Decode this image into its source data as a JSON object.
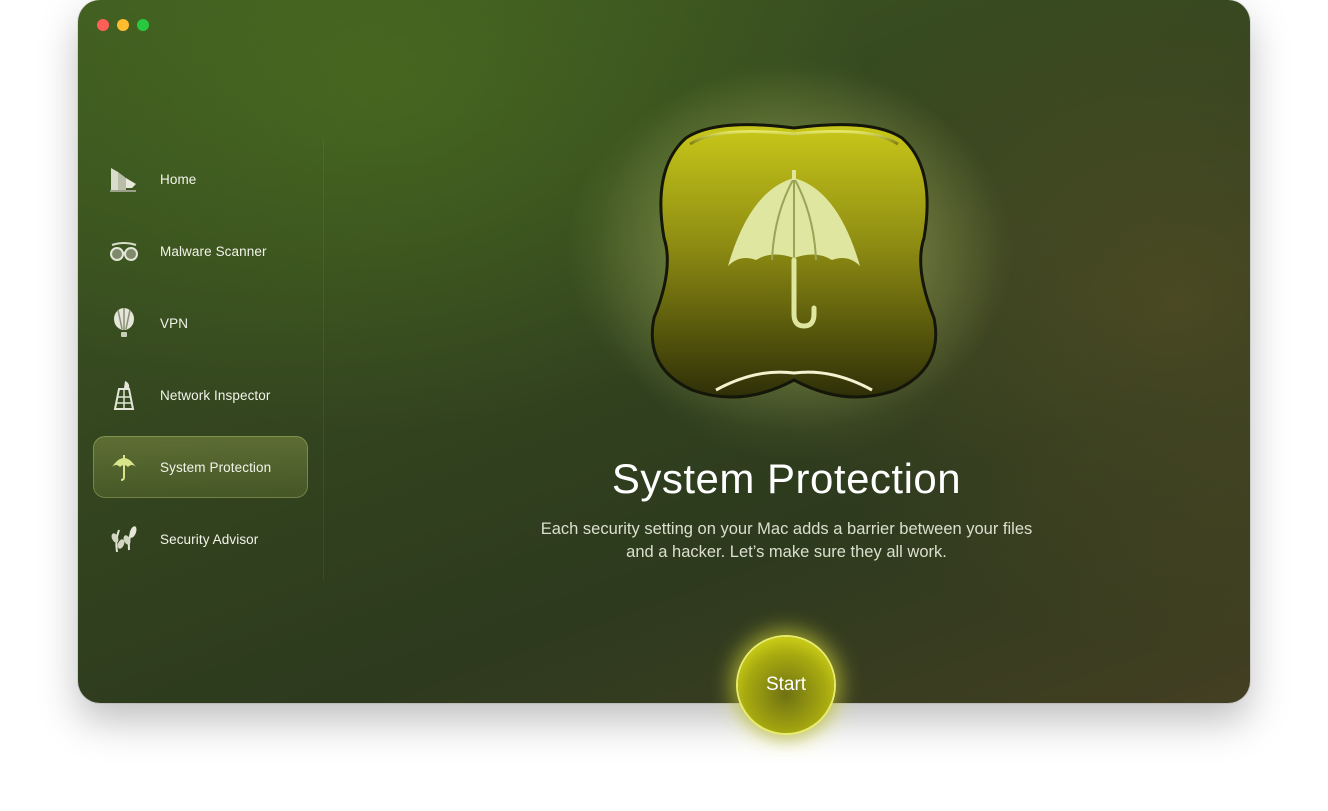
{
  "window": {
    "traffic_lights": [
      "close",
      "minimize",
      "zoom"
    ]
  },
  "sidebar": {
    "items": [
      {
        "label": "Home",
        "icon": "home-icon",
        "active": false
      },
      {
        "label": "Malware Scanner",
        "icon": "goggles-icon",
        "active": false
      },
      {
        "label": "VPN",
        "icon": "balloon-icon",
        "active": false
      },
      {
        "label": "Network Inspector",
        "icon": "tower-icon",
        "active": false
      },
      {
        "label": "System Protection",
        "icon": "umbrella-icon",
        "active": true
      },
      {
        "label": "Security Advisor",
        "icon": "leaves-icon",
        "active": false
      }
    ]
  },
  "main": {
    "icon": "umbrella-icon",
    "title": "System Protection",
    "description_line1": "Each security setting on your Mac adds a barrier between your files",
    "description_line2": "and a hacker. Let’s make sure they all work.",
    "start_label": "Start"
  },
  "colors": {
    "accent": "#d7d91a",
    "window_bg": "#34461f"
  }
}
